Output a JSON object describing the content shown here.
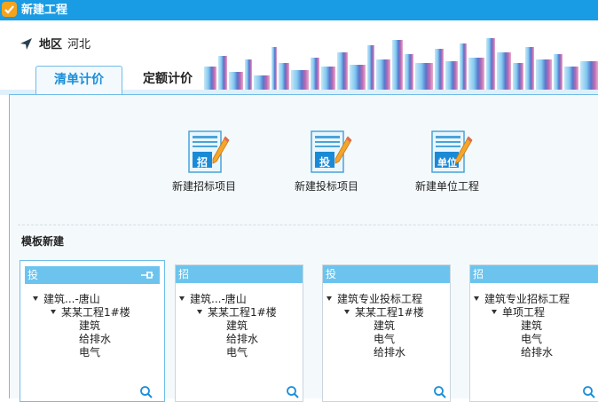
{
  "window": {
    "title": "新建工程"
  },
  "region": {
    "label": "地区",
    "value": "河北"
  },
  "tabs": [
    {
      "label": "清单计价",
      "active": true
    },
    {
      "label": "定额计价",
      "active": false
    }
  ],
  "actions": [
    {
      "label": "新建招标项目",
      "badge": "招",
      "icon": "tender-document-icon"
    },
    {
      "label": "新建投标项目",
      "badge": "投",
      "icon": "bid-document-icon"
    },
    {
      "label": "新建单位工程",
      "badge": "单位",
      "icon": "unit-document-icon"
    }
  ],
  "templates": {
    "title": "模板新建",
    "cards": [
      {
        "badge": "投",
        "selected": true,
        "tree": [
          "建筑...-唐山",
          "某某工程1#楼",
          "建筑",
          "给排水",
          "电气"
        ]
      },
      {
        "badge": "招",
        "selected": false,
        "tree": [
          "建筑...-唐山",
          "某某工程1#楼",
          "建筑",
          "给排水",
          "电气"
        ]
      },
      {
        "badge": "投",
        "selected": false,
        "tree": [
          "建筑专业投标工程",
          "某某工程1#楼",
          "建筑",
          "电气",
          "给排水"
        ]
      },
      {
        "badge": "招",
        "selected": false,
        "tree": [
          "建筑专业招标工程",
          "单项工程",
          "建筑",
          "电气",
          "给排水"
        ]
      }
    ]
  },
  "colors": {
    "titlebar": "#1a9ce4",
    "accent": "#1a8fd9",
    "card_header": "#6cc4ee",
    "panel": "#f4f9fc"
  }
}
